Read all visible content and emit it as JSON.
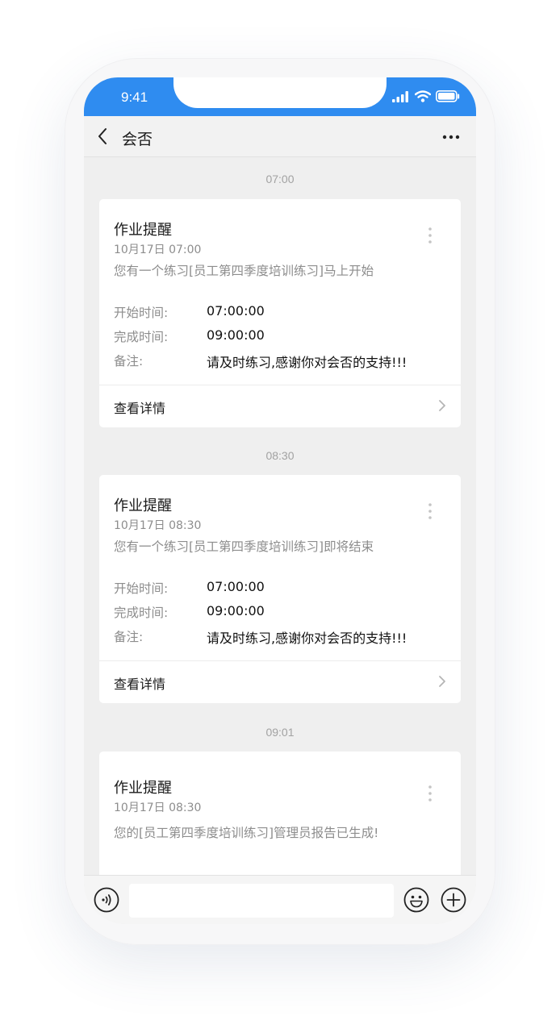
{
  "status_bar": {
    "time": "9:41"
  },
  "nav": {
    "title": "会否"
  },
  "messages": [
    {
      "time": "07:00",
      "title": "作业提醒",
      "date": "10月17日  07:00",
      "desc": "您有一个练习[员工第四季度培训练习]马上开始",
      "fields": [
        {
          "label": "开始时间:",
          "value": "07:00:00"
        },
        {
          "label": "完成时间:",
          "value": "09:00:00"
        },
        {
          "label": "备注:",
          "value": "请及时练习,感谢你对会否的支持!!!"
        }
      ],
      "link": "查看详情"
    },
    {
      "time": "08:30",
      "title": "作业提醒",
      "date": "10月17日  08:30",
      "desc": "您有一个练习[员工第四季度培训练习]即将结束",
      "fields": [
        {
          "label": "开始时间:",
          "value": "07:00:00"
        },
        {
          "label": "完成时间:",
          "value": "09:00:00"
        },
        {
          "label": "备注:",
          "value": "请及时练习,感谢你对会否的支持!!!"
        }
      ],
      "link": "查看详情"
    },
    {
      "time": "09:01",
      "title": "作业提醒",
      "date": "10月17日  08:30",
      "desc": "您的[员工第四季度培训练习]管理员报告已生成!"
    }
  ],
  "input": {
    "placeholder": ""
  },
  "colors": {
    "accent": "#2f8cf0",
    "background": "#efefef",
    "card": "#ffffff",
    "muted_text": "#8d8d8d"
  },
  "icons": [
    "back-icon",
    "more-icon",
    "card-menu-icon",
    "chevron-right-icon",
    "voice-icon",
    "emoji-icon",
    "plus-icon",
    "signal-icon",
    "wifi-icon",
    "battery-icon"
  ]
}
